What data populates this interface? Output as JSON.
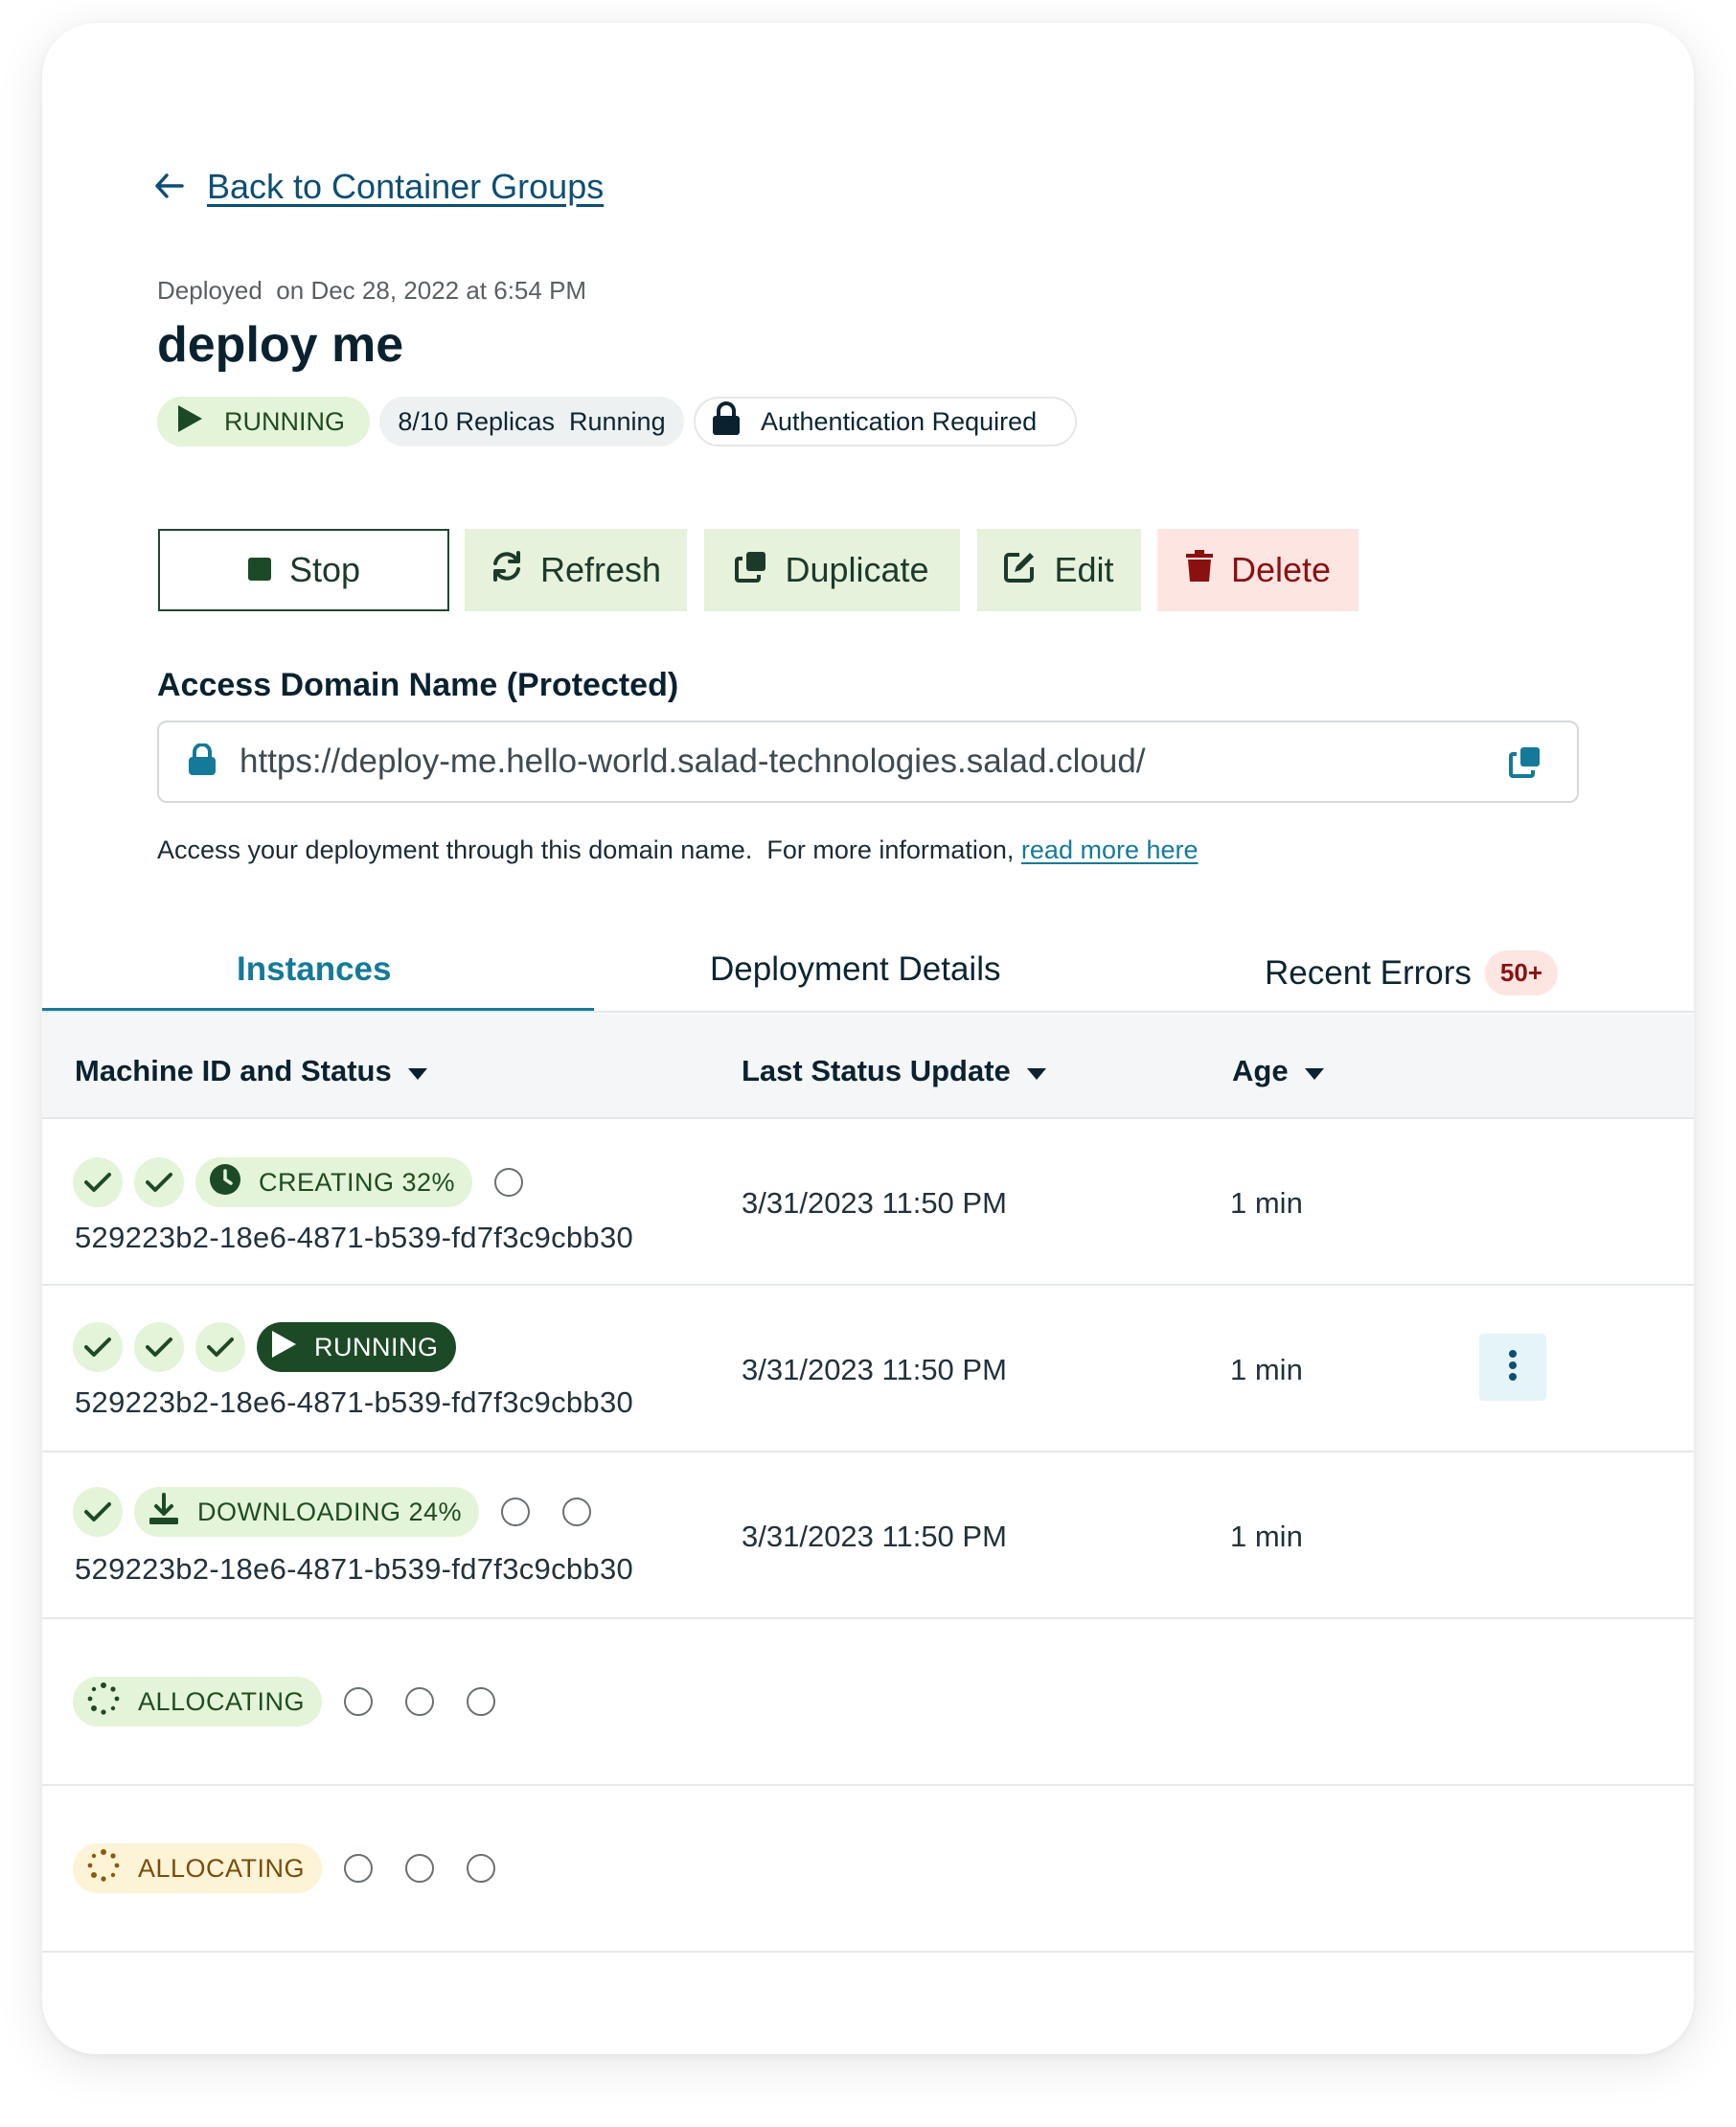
{
  "back_link": {
    "label": "Back to Container Groups"
  },
  "header": {
    "deployed_text": "Deployed  on Dec 28, 2022 at 6:54 PM",
    "title": "deploy me"
  },
  "badges": {
    "status": "RUNNING",
    "replicas": "8/10 Replicas  Running",
    "auth": "Authentication Required"
  },
  "actions": {
    "stop": "Stop",
    "refresh": "Refresh",
    "duplicate": "Duplicate",
    "edit": "Edit",
    "delete": "Delete"
  },
  "access_domain": {
    "title": "Access Domain Name (Protected)",
    "url": "https://deploy-me.hello-world.salad-technologies.salad.cloud/",
    "help_text": "Access your deployment through this domain name.  For more information, ",
    "help_link": "read more here"
  },
  "tabs": [
    {
      "label": "Instances"
    },
    {
      "label": "Deployment Details"
    },
    {
      "label": "Recent Errors",
      "badge": "50+"
    }
  ],
  "table": {
    "columns": [
      "Machine ID and Status",
      "Last Status Update",
      "Age"
    ],
    "rows": [
      {
        "status": "CREATING 32%",
        "machine_id": "529223b2-18e6-4871-b539-fd7f3c9cbb30",
        "last_update": "3/31/2023 11:50 PM",
        "age": "1 min"
      },
      {
        "status": "RUNNING",
        "machine_id": "529223b2-18e6-4871-b539-fd7f3c9cbb30",
        "last_update": "3/31/2023 11:50 PM",
        "age": "1 min"
      },
      {
        "status": "DOWNLOADING 24%",
        "machine_id": "529223b2-18e6-4871-b539-fd7f3c9cbb30",
        "last_update": "3/31/2023 11:50 PM",
        "age": "1 min"
      },
      {
        "status": "ALLOCATING"
      },
      {
        "status": "ALLOCATING"
      }
    ]
  },
  "colors": {
    "accent": "#157a9a",
    "running_dark": "#1d4a26",
    "success_bg": "#e3f4d9",
    "danger": "#8a1111",
    "danger_bg": "#fde5e2",
    "warning_bg": "#fdf3d6"
  },
  "icons": {
    "back": "arrow-left-icon",
    "play": "play-icon",
    "lock": "lock-icon",
    "stop": "stop-square-icon",
    "refresh": "refresh-icon",
    "duplicate": "duplicate-icon",
    "edit": "edit-icon",
    "delete": "trash-icon",
    "copy": "copy-icon",
    "sort": "caret-down-icon",
    "check": "check-icon",
    "clock": "clock-icon",
    "download": "download-icon",
    "spinner": "spinner-icon",
    "more": "kebab-menu-icon"
  }
}
